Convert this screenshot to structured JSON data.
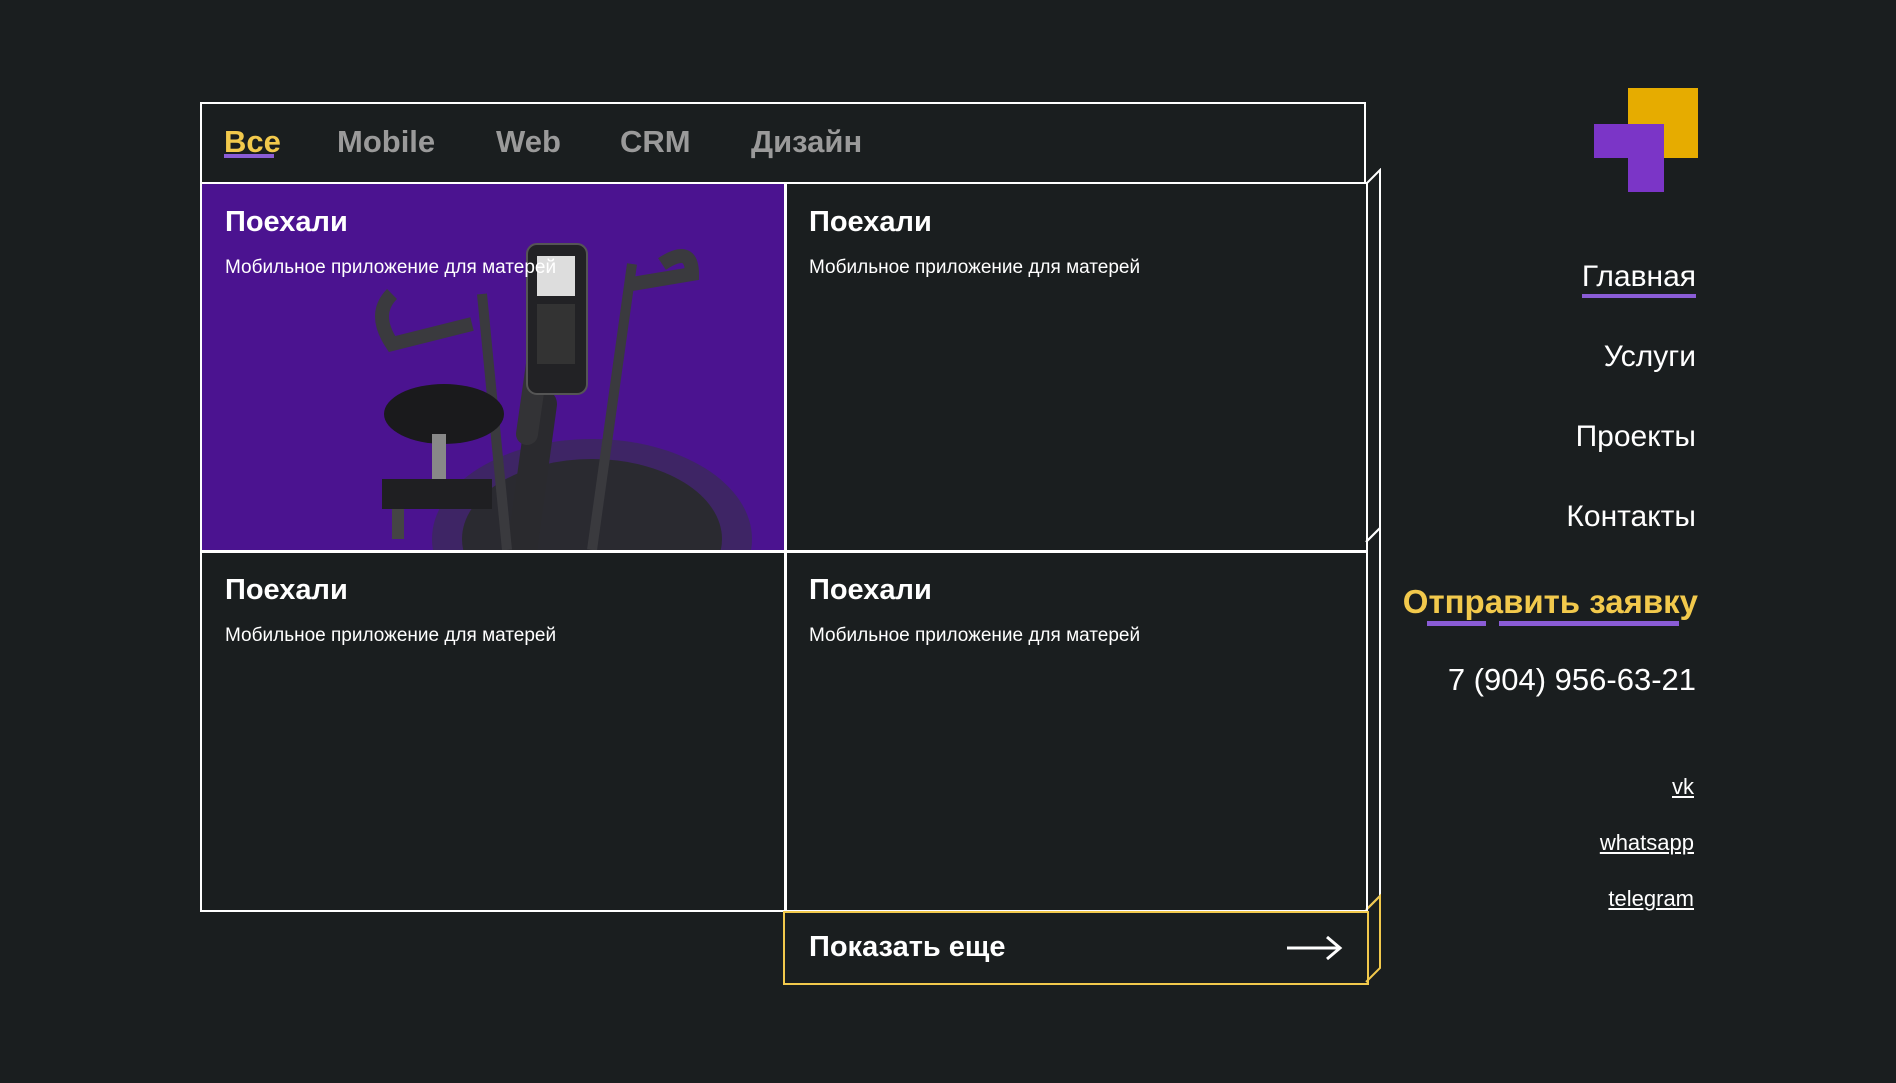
{
  "tabs": [
    {
      "label": "Все",
      "active": true
    },
    {
      "label": "Mobile",
      "active": false
    },
    {
      "label": "Web",
      "active": false
    },
    {
      "label": "CRM",
      "active": false
    },
    {
      "label": "Дизайн",
      "active": false
    }
  ],
  "projects": [
    {
      "title": "Поехали",
      "subtitle": "Мобильное приложение для матерей",
      "image": "exercise-bike",
      "background": "#4b1390"
    },
    {
      "title": "Поехали",
      "subtitle": "Мобильное приложение для матерей"
    },
    {
      "title": "Поехали",
      "subtitle": "Мобильное приложение для матерей"
    },
    {
      "title": "Поехали",
      "subtitle": "Мобильное приложение для матерей"
    }
  ],
  "show_more": {
    "label": "Показать еще",
    "icon": "arrow-right-icon"
  },
  "nav": [
    {
      "label": "Главная",
      "active": true
    },
    {
      "label": "Услуги",
      "active": false
    },
    {
      "label": "Проекты",
      "active": false
    },
    {
      "label": "Контакты",
      "active": false
    }
  ],
  "cta": {
    "label": "Отправить заявку"
  },
  "phone": "7 (904) 956-63-21",
  "social": [
    {
      "label": "vk"
    },
    {
      "label": "whatsapp"
    },
    {
      "label": "telegram"
    }
  ],
  "colors": {
    "background": "#1a1e1f",
    "accent_yellow": "#f2c94c",
    "accent_purple": "#8a5cd6",
    "logo_yellow": "#e6ac00",
    "logo_purple": "#7b35c7",
    "card_purple": "#4b1390"
  }
}
